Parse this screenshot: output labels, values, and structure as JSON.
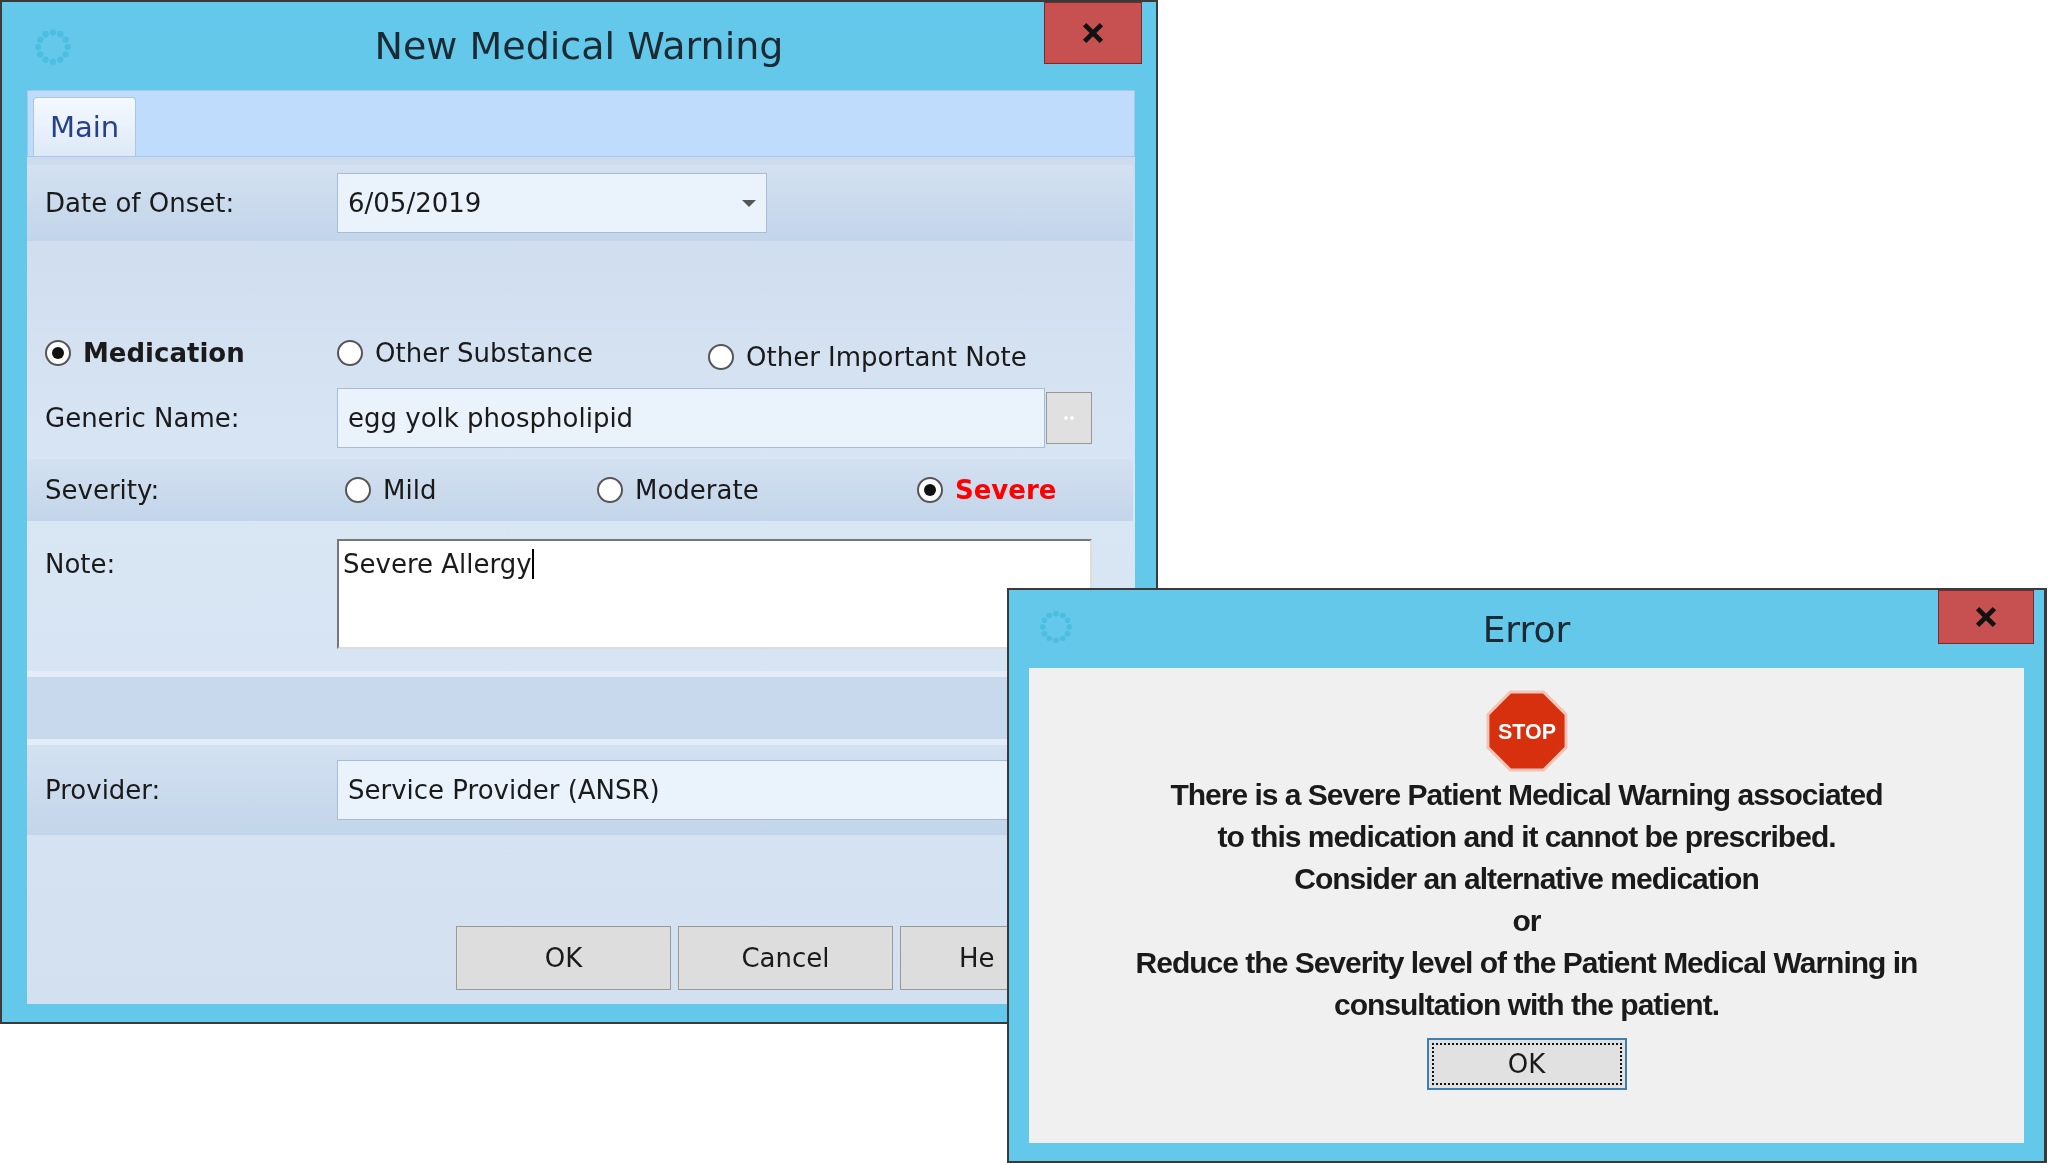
{
  "main_window": {
    "title": "New Medical Warning",
    "tabs": [
      {
        "label": "Main",
        "selected": true
      }
    ],
    "date_of_onset": {
      "label": "Date of Onset:",
      "value": "6/05/2019"
    },
    "warning_type": [
      {
        "label": "Medication",
        "selected": true
      },
      {
        "label": "Other Substance",
        "selected": false
      },
      {
        "label": "Other Important Note",
        "selected": false
      }
    ],
    "generic_name": {
      "label": "Generic Name:",
      "value": "egg yolk phospholipid"
    },
    "severity": {
      "label": "Severity:",
      "options": [
        {
          "label": "Mild",
          "selected": false,
          "color": "#1a1a1a"
        },
        {
          "label": "Moderate",
          "selected": false,
          "color": "#1a1a1a"
        },
        {
          "label": "Severe",
          "selected": true,
          "color": "#ff0000"
        }
      ]
    },
    "note": {
      "label": "Note:",
      "value": "Severe Allergy"
    },
    "provider": {
      "label": "Provider:",
      "value": "Service Provider (ANSR)"
    },
    "buttons": [
      "OK",
      "Cancel",
      "He"
    ]
  },
  "error_dialog": {
    "title": "Error",
    "icon_text": "STOP",
    "message_lines": [
      "There is a Severe Patient Medical Warning associated",
      "to this medication and it cannot be prescribed.",
      "Consider an alternative medication",
      "or",
      "Reduce the Severity level of the Patient Medical Warning in",
      "consultation with the patient."
    ],
    "button": {
      "label": "OK",
      "focused": true
    }
  }
}
